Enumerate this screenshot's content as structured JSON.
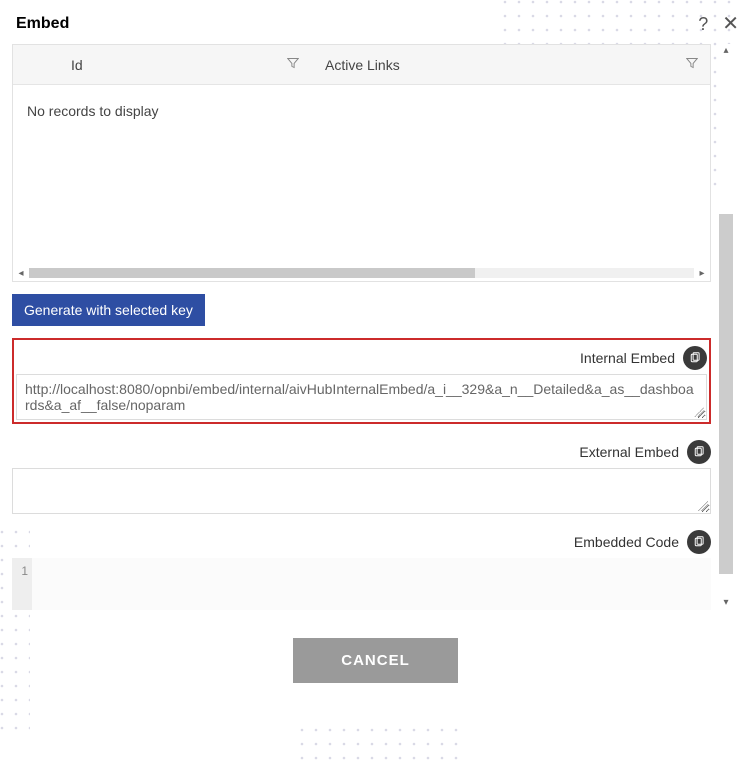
{
  "dialog": {
    "title": "Embed"
  },
  "grid": {
    "columns": {
      "id": "Id",
      "active_links": "Active Links"
    },
    "empty_message": "No records to display"
  },
  "buttons": {
    "generate": "Generate with selected key",
    "cancel": "CANCEL"
  },
  "embeds": {
    "internal": {
      "label": "Internal Embed",
      "value": "http://localhost:8080/opnbi/embed/internal/aivHubInternalEmbed/a_i__329&a_n__Detailed&a_as__dashboards&a_af__false/noparam"
    },
    "external": {
      "label": "External Embed",
      "value": ""
    },
    "code": {
      "label": "Embedded Code",
      "value": "",
      "line_number": "1"
    }
  }
}
